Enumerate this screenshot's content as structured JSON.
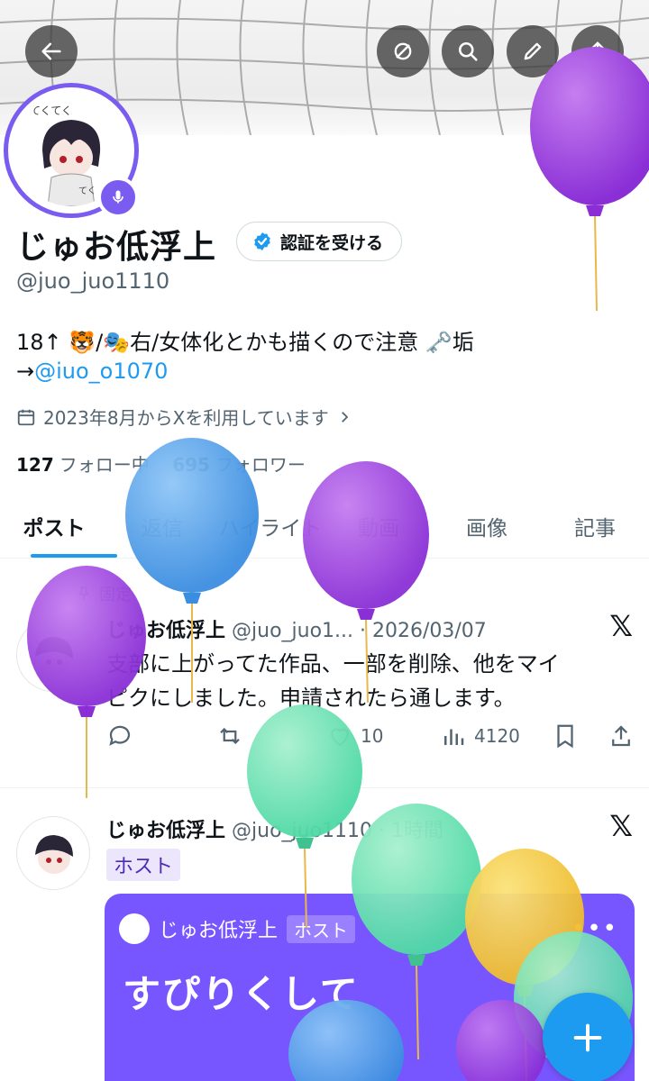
{
  "header": {
    "back_icon": "arrow-left-icon",
    "actions": [
      "mute-icon",
      "search-icon",
      "edit-icon",
      "share-icon"
    ]
  },
  "profile": {
    "name": "じゅお低浮上",
    "verify_label": "認証を受ける",
    "handle": "@juo_juo1110",
    "bio_line1": "18↑ 🐯/🎭右/女体化とかも描くので注意 🗝️垢",
    "bio_line2_prefix": "→",
    "bio_link": "@iuo_o1070",
    "joined": "2023年8月からXを利用しています",
    "following_count": "127",
    "following_label": "フォロー中",
    "followers_count": "695",
    "followers_label": "フォロワー"
  },
  "tabs": [
    {
      "label": "ポスト"
    },
    {
      "label": "返信"
    },
    {
      "label": "ハイライト"
    },
    {
      "label": "動画"
    },
    {
      "label": "画像"
    },
    {
      "label": "記事"
    }
  ],
  "posts": [
    {
      "pinned_label": "固定",
      "author": "じゅお低浮上",
      "meta": "@juo_juo1... · 2026/03/07",
      "text_line1": "支部に上がってた作品、一部を削除、他をマイ",
      "text_line2": "ピクにしました。申請されたら通します。",
      "likes": "10",
      "views": "4120"
    },
    {
      "author": "じゅお低浮上",
      "meta": "@juo_juo1110 · 1時間",
      "host_label": "ホスト",
      "space": {
        "host_name": "じゅお低浮上",
        "host_badge": "ホスト",
        "dots": "•••",
        "title": "すぴりくして"
      }
    }
  ],
  "colors": {
    "accent": "#1d9bf0",
    "space": "#7856ff",
    "avatar_ring": "#7b5cf0"
  }
}
